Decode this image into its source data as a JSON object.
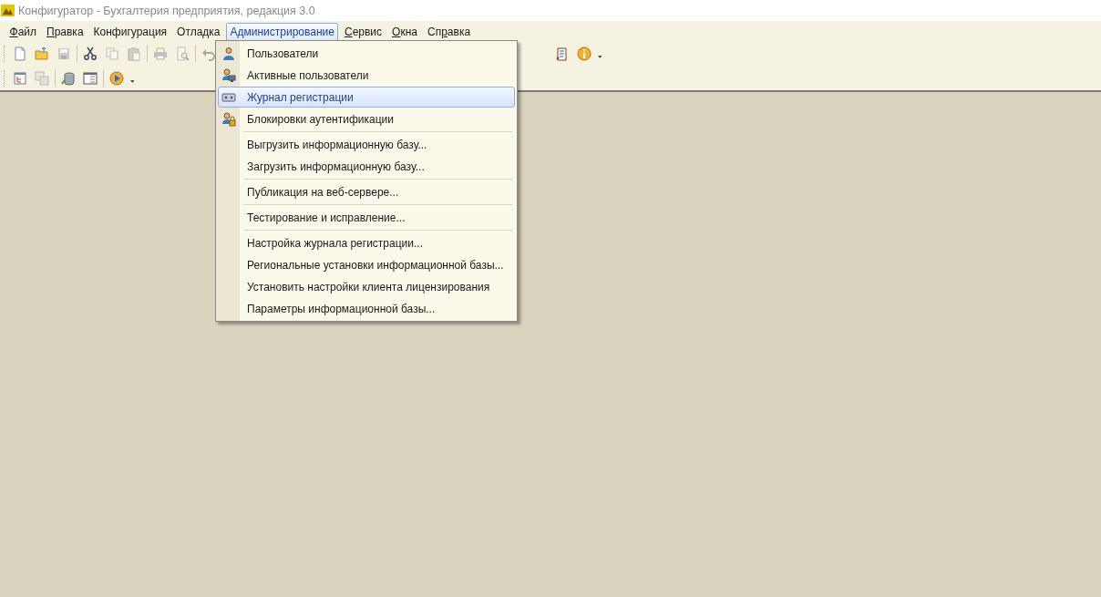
{
  "window": {
    "title": "Конфигуратор - Бухгалтерия предприятия, редакция 3.0"
  },
  "menu_bar": [
    {
      "parts": [
        {
          "text": "Ф",
          "underlined": true
        },
        {
          "text": "айл",
          "underlined": false
        }
      ],
      "selected": false
    },
    {
      "parts": [
        {
          "text": "П",
          "underlined": true
        },
        {
          "text": "равка",
          "underlined": false
        }
      ],
      "selected": false
    },
    {
      "label": "Конфигурация",
      "selected": false
    },
    {
      "label": "Отладка",
      "selected": false
    },
    {
      "label": "Администрирование",
      "selected": true
    },
    {
      "parts": [
        {
          "text": "С",
          "underlined": true
        },
        {
          "text": "ервис",
          "underlined": false
        }
      ],
      "selected": false
    },
    {
      "parts": [
        {
          "text": "О",
          "underlined": true
        },
        {
          "text": "кна",
          "underlined": false
        }
      ],
      "selected": false
    },
    {
      "parts": [
        {
          "text": "Сп",
          "underlined": false
        },
        {
          "text": "р",
          "underlined": true
        },
        {
          "text": "авка",
          "underlined": false
        }
      ],
      "selected": false
    }
  ],
  "toolbars": [
    {
      "buttons": [
        {
          "kind": "new",
          "disabled": false
        },
        {
          "kind": "open",
          "disabled": false
        },
        {
          "kind": "save",
          "disabled": true
        },
        {
          "kind": "separator"
        },
        {
          "kind": "cut",
          "disabled": false
        },
        {
          "kind": "copy",
          "disabled": true
        },
        {
          "kind": "paste",
          "disabled": true
        },
        {
          "kind": "separator"
        },
        {
          "kind": "print",
          "disabled": true
        },
        {
          "kind": "preview",
          "disabled": true
        },
        {
          "kind": "separator"
        },
        {
          "kind": "undo",
          "disabled": true
        },
        {
          "kind": "gap"
        },
        {
          "kind": "document",
          "disabled": false
        },
        {
          "kind": "info",
          "disabled": false
        },
        {
          "kind": "caret",
          "disabled": false
        }
      ]
    },
    {
      "buttons": [
        {
          "kind": "tree",
          "disabled": false
        },
        {
          "kind": "compare",
          "disabled": true
        },
        {
          "kind": "separator"
        },
        {
          "kind": "database",
          "disabled": false
        },
        {
          "kind": "window",
          "disabled": false
        },
        {
          "kind": "separator"
        },
        {
          "kind": "run",
          "disabled": false
        },
        {
          "kind": "caret",
          "disabled": false
        }
      ]
    }
  ],
  "dropdown_menu": {
    "items": [
      {
        "kind": "icon_item",
        "label": "Пользователи",
        "selected": false
      },
      {
        "kind": "icon_item",
        "label": "Активные пользователи",
        "selected": false
      },
      {
        "kind": "icon_item",
        "label": "Журнал регистрации",
        "selected": true
      },
      {
        "kind": "icon_item",
        "label": "Блокировки аутентификации",
        "selected": false
      },
      {
        "kind": "separator"
      },
      {
        "kind": "item",
        "label": "Выгрузить информационную базу...",
        "selected": false
      },
      {
        "kind": "item",
        "label": "Загрузить информационную базу...",
        "selected": false
      },
      {
        "kind": "separator"
      },
      {
        "kind": "item",
        "label": "Публикация на веб-сервере...",
        "selected": false
      },
      {
        "kind": "separator"
      },
      {
        "kind": "item",
        "label": "Тестирование и исправление...",
        "selected": false
      },
      {
        "kind": "separator"
      },
      {
        "kind": "item",
        "label": "Настройка журнала регистрации...",
        "selected": false
      },
      {
        "kind": "item",
        "label": "Региональные установки информационной базы...",
        "selected": false
      },
      {
        "kind": "item",
        "label": "Установить настройки клиента лицензирования",
        "selected": false
      },
      {
        "kind": "item",
        "label": "Параметры информационной базы...",
        "selected": false
      }
    ]
  }
}
